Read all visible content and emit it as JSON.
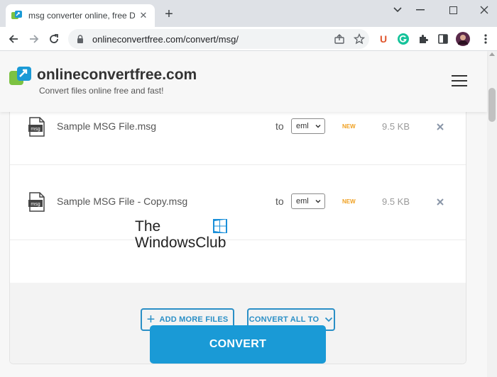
{
  "browser": {
    "tab_title": "msg converter online, free Docu",
    "url": "onlineconvertfree.com/convert/msg/",
    "new_tab": "+",
    "tab_close": "✕"
  },
  "site": {
    "logo_text": "onlineconvertfree.com",
    "tagline": "Convert files online free and fast!"
  },
  "files": [
    {
      "name": "Sample MSG File.msg",
      "to_label": "to",
      "format": "eml",
      "badge": "NEW",
      "size": "9.5 KB",
      "icon_label": "msg"
    },
    {
      "name": "Sample MSG File - Copy.msg",
      "to_label": "to",
      "format": "eml",
      "badge": "NEW",
      "size": "9.5 KB",
      "icon_label": "msg"
    }
  ],
  "actions": {
    "add_more_plus": "+",
    "add_more_label": "ADD MORE FILES",
    "convert_all_label": "CONVERT ALL TO"
  },
  "watermark": {
    "line1": "The",
    "line2": "WindowsClub"
  },
  "convert_label": "CONVERT",
  "colors": {
    "accent": "#1a9ad6",
    "outline_accent": "#2a8fc6",
    "badge": "#f0a020"
  }
}
